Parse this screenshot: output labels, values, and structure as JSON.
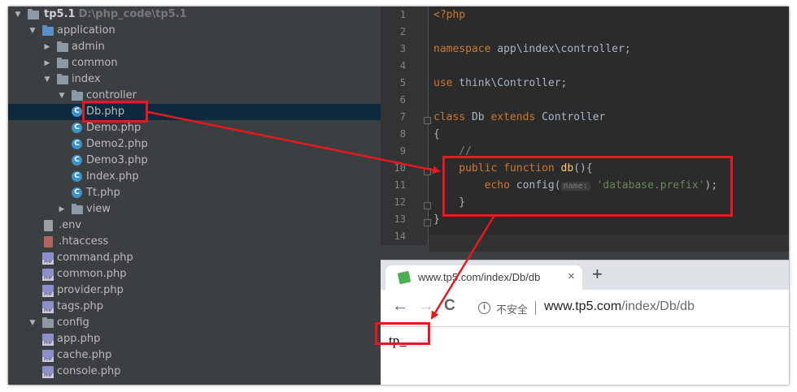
{
  "tree": {
    "root": {
      "name": "tp5.1",
      "path": "D:\\php_code\\tp5.1"
    },
    "items": [
      {
        "label": "application",
        "type": "folder-blue",
        "expanded": true
      },
      {
        "label": "admin",
        "type": "folder",
        "expanded": false
      },
      {
        "label": "common",
        "type": "folder",
        "expanded": false
      },
      {
        "label": "index",
        "type": "folder",
        "expanded": true
      },
      {
        "label": "controller",
        "type": "folder",
        "expanded": true
      },
      {
        "label": "Db.php",
        "type": "class",
        "selected": true
      },
      {
        "label": "Demo.php",
        "type": "class"
      },
      {
        "label": "Demo2.php",
        "type": "class"
      },
      {
        "label": "Demo3.php",
        "type": "class"
      },
      {
        "label": "Index.php",
        "type": "class"
      },
      {
        "label": "Tt.php",
        "type": "class"
      },
      {
        "label": "view",
        "type": "folder",
        "expanded": false
      },
      {
        "label": ".env",
        "type": "env"
      },
      {
        "label": ".htaccess",
        "type": "htaccess"
      },
      {
        "label": "command.php",
        "type": "php"
      },
      {
        "label": "common.php",
        "type": "php"
      },
      {
        "label": "provider.php",
        "type": "php"
      },
      {
        "label": "tags.php",
        "type": "php"
      },
      {
        "label": "config",
        "type": "folder",
        "expanded": true
      },
      {
        "label": "app.php",
        "type": "php"
      },
      {
        "label": "cache.php",
        "type": "php"
      },
      {
        "label": "console.php",
        "type": "php"
      }
    ]
  },
  "editor": {
    "line_numbers": [
      "1",
      "2",
      "3",
      "4",
      "5",
      "6",
      "7",
      "8",
      "9",
      "10",
      "11",
      "12",
      "13",
      "14"
    ],
    "lines": {
      "l1": "<?php",
      "l3_kw": "namespace",
      "l3_rest": " app\\index\\controller;",
      "l5_kw": "use",
      "l5_rest": " think\\Controller;",
      "l7_kw1": "class",
      "l7_name": " Db ",
      "l7_kw2": "extends",
      "l7_rest": " Controller",
      "l8": "{",
      "l9": "    //",
      "l10_kw": "    public function ",
      "l10_fn": "db",
      "l10_rest": "(){",
      "l11_kw": "        echo ",
      "l11_call": "config(",
      "l11_hint": "name:",
      "l11_str": "'database.prefix'",
      "l11_rest": ");",
      "l12": "    }",
      "l13": "}"
    }
  },
  "browser": {
    "tab_title": "www.tp5.com/index/Db/db",
    "tab_close": "×",
    "new_tab": "+",
    "back": "←",
    "forward": "→",
    "reload": "C",
    "info": "i",
    "insecure_label": "不安全",
    "url_host": "www.tp5.com",
    "url_path": "/index/Db/db",
    "output": "tp_"
  },
  "colors": {
    "highlight": "#e5191f",
    "selection": "#0d293e",
    "editor_bg": "#2b2b2b",
    "tree_bg": "#3c3f41"
  }
}
